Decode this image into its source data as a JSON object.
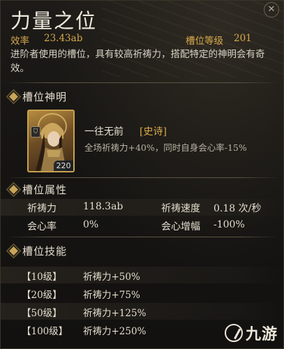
{
  "header": {
    "title": "力量之位",
    "efficiency_label": "效率",
    "efficiency_value": "23.43ab",
    "slot_level_label": "槽位等级",
    "slot_level_value": "201",
    "close_icon": "close-icon"
  },
  "description": "进阶者使用的槽位，具有较高祈祷力，搭配特定的神明会有奇效。",
  "slot_god": {
    "section_title": "槽位神明",
    "name": "一往无前",
    "rarity": "[史诗]",
    "effect": "全场祈祷力+40%，同时自身会心率-15%",
    "card_level": "220",
    "class_icon": "shield-class-icon"
  },
  "attributes": {
    "section_title": "槽位属性",
    "rows": [
      {
        "label_a": "祈祷力",
        "value_a": "118.3ab",
        "label_b": "祈祷速度",
        "value_b": "0.18 次/秒"
      },
      {
        "label_a": "会心率",
        "value_a": "0%",
        "label_b": "会心增幅",
        "value_b": "-100%"
      }
    ]
  },
  "skills": {
    "section_title": "槽位技能",
    "rows": [
      {
        "level": "【10级】",
        "effect": "祈祷力+50%"
      },
      {
        "level": "【20级】",
        "effect": "祈祷力+75%"
      },
      {
        "level": "【50级】",
        "effect": "祈祷力+125%"
      },
      {
        "level": "【100级】",
        "effect": "祈祷力+250%"
      }
    ]
  },
  "watermark": {
    "text": "九游",
    "logo_icon": "jiuyou-logo-icon"
  },
  "colors": {
    "gold_text": "#d6a84a",
    "rarity": "#d9a949",
    "background": "#161513"
  }
}
